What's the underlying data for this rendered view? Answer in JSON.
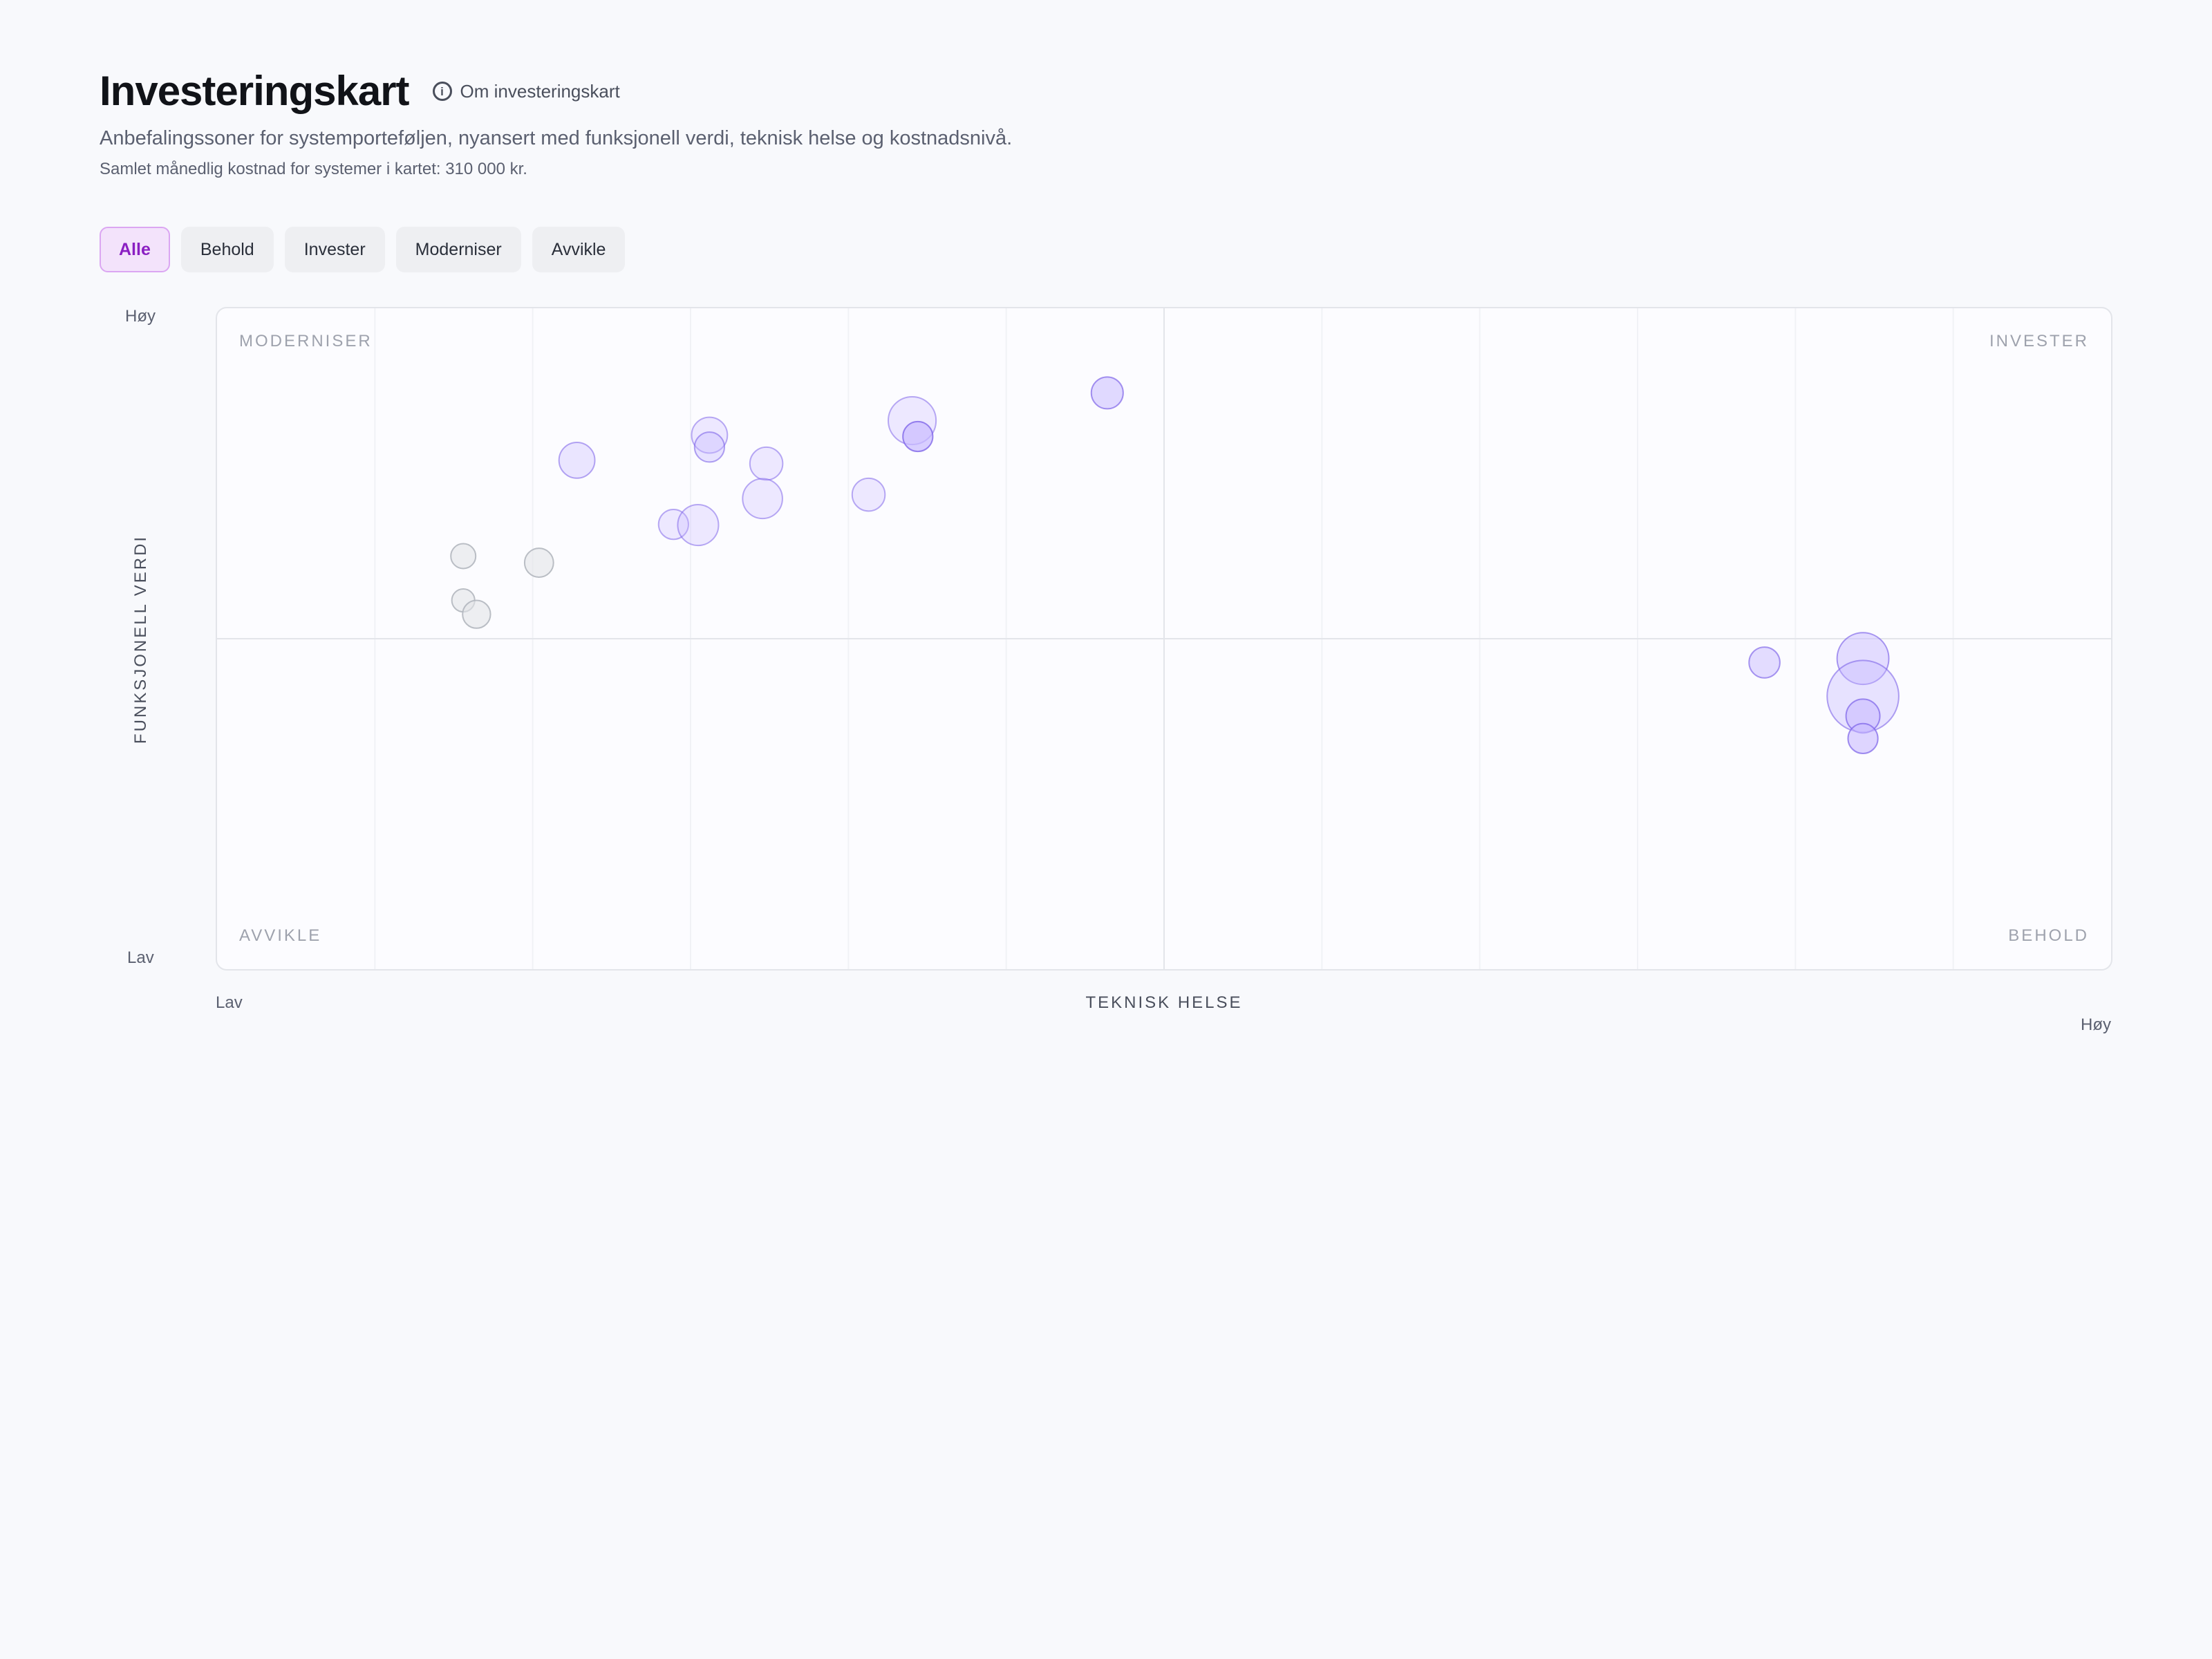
{
  "header": {
    "title": "Investeringskart",
    "about_link": "Om investeringskart",
    "info_icon": "info-icon",
    "subtitle": "Anbefalingssoner for systemporteføljen, nyansert med funksjonell verdi, teknisk helse og kostnadsnivå.",
    "cost_line": "Samlet månedlig kostnad for systemer i kartet: 310 000 kr."
  },
  "filters": {
    "active": "Alle",
    "items": [
      "Alle",
      "Behold",
      "Invester",
      "Moderniser",
      "Avvikle"
    ]
  },
  "colors": {
    "accent": "#8a1fc2",
    "bubble_fill": "#c9bbff",
    "bubble_stroke": "#7c62e8",
    "bubble_gray_fill": "#e2e4e8",
    "bubble_gray_stroke": "#b3b7bf"
  },
  "chart_data": {
    "type": "scatter",
    "xlabel": "TEKNISK HELSE",
    "ylabel": "FUNKSJONELL VERDI",
    "x_low": "Lav",
    "x_high": "Høy",
    "y_low": "Lav",
    "y_high": "Høy",
    "xlim": [
      0,
      1
    ],
    "ylim": [
      0,
      1
    ],
    "quadrants": {
      "top_left": "MODERNISER",
      "top_right": "INVESTER",
      "bottom_left": "AVVIKLE",
      "bottom_right": "BEHOLD"
    },
    "bubbles": [
      {
        "x": 0.47,
        "y": 0.872,
        "size": 0.32,
        "tone": "purple",
        "intensity": 0.55
      },
      {
        "x": 0.367,
        "y": 0.83,
        "size": 0.48,
        "tone": "purple",
        "intensity": 0.3
      },
      {
        "x": 0.37,
        "y": 0.806,
        "size": 0.3,
        "tone": "purple",
        "intensity": 0.7
      },
      {
        "x": 0.26,
        "y": 0.808,
        "size": 0.36,
        "tone": "purple",
        "intensity": 0.3
      },
      {
        "x": 0.26,
        "y": 0.79,
        "size": 0.3,
        "tone": "purple",
        "intensity": 0.4
      },
      {
        "x": 0.19,
        "y": 0.77,
        "size": 0.36,
        "tone": "purple",
        "intensity": 0.35
      },
      {
        "x": 0.29,
        "y": 0.765,
        "size": 0.33,
        "tone": "purple",
        "intensity": 0.3
      },
      {
        "x": 0.344,
        "y": 0.718,
        "size": 0.33,
        "tone": "purple",
        "intensity": 0.3
      },
      {
        "x": 0.288,
        "y": 0.712,
        "size": 0.4,
        "tone": "purple",
        "intensity": 0.3
      },
      {
        "x": 0.241,
        "y": 0.673,
        "size": 0.3,
        "tone": "purple",
        "intensity": 0.3
      },
      {
        "x": 0.254,
        "y": 0.672,
        "size": 0.41,
        "tone": "purple",
        "intensity": 0.3
      },
      {
        "x": 0.13,
        "y": 0.625,
        "size": 0.25,
        "tone": "gray",
        "intensity": 0.5
      },
      {
        "x": 0.17,
        "y": 0.615,
        "size": 0.29,
        "tone": "gray",
        "intensity": 0.5
      },
      {
        "x": 0.13,
        "y": 0.558,
        "size": 0.23,
        "tone": "gray",
        "intensity": 0.5
      },
      {
        "x": 0.137,
        "y": 0.537,
        "size": 0.28,
        "tone": "gray",
        "intensity": 0.5
      },
      {
        "x": 0.817,
        "y": 0.464,
        "size": 0.31,
        "tone": "purple",
        "intensity": 0.5
      },
      {
        "x": 0.869,
        "y": 0.47,
        "size": 0.52,
        "tone": "purple",
        "intensity": 0.5
      },
      {
        "x": 0.869,
        "y": 0.413,
        "size": 0.72,
        "tone": "purple",
        "intensity": 0.4
      },
      {
        "x": 0.869,
        "y": 0.383,
        "size": 0.34,
        "tone": "purple",
        "intensity": 0.6
      },
      {
        "x": 0.869,
        "y": 0.349,
        "size": 0.3,
        "tone": "purple",
        "intensity": 0.6
      }
    ]
  }
}
